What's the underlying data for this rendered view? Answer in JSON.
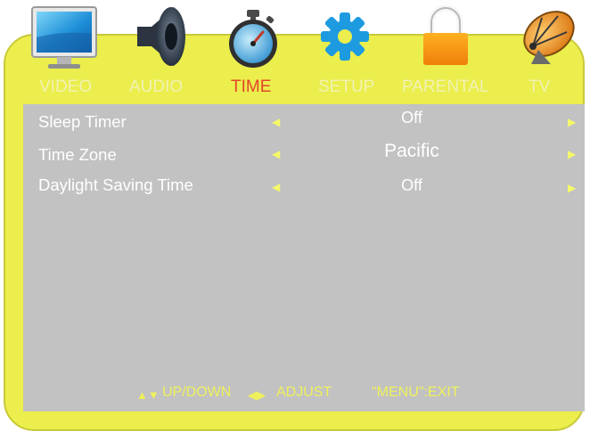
{
  "colors": {
    "frame": "#ebee4c",
    "panel": "#c2c2c2",
    "tab_inactive": "#f1f2b3",
    "tab_active": "#e4462b",
    "accent": "#f5f86a"
  },
  "tabs": [
    {
      "label": "VIDEO",
      "icon": "monitor-icon",
      "active": false
    },
    {
      "label": "AUDIO",
      "icon": "speaker-icon",
      "active": false
    },
    {
      "label": "TIME",
      "icon": "stopwatch-icon",
      "active": true
    },
    {
      "label": "SETUP",
      "icon": "gear-icon",
      "active": false
    },
    {
      "label": "PARENTAL",
      "icon": "padlock-icon",
      "active": false
    },
    {
      "label": "TV",
      "icon": "satellite-dish-icon",
      "active": false
    }
  ],
  "settings": [
    {
      "label": "Sleep Timer",
      "value": "Off"
    },
    {
      "label": "Time Zone",
      "value": "Pacific"
    },
    {
      "label": "Daylight Saving Time",
      "value": "Off"
    }
  ],
  "arrows": {
    "left": "◀",
    "right": "▶"
  },
  "hints": {
    "updown_glyph": "▲▼",
    "updown": "UP/DOWN",
    "adjust_glyph": "◀▶",
    "adjust": "ADJUST",
    "exit": "\"MENU\":EXIT"
  }
}
